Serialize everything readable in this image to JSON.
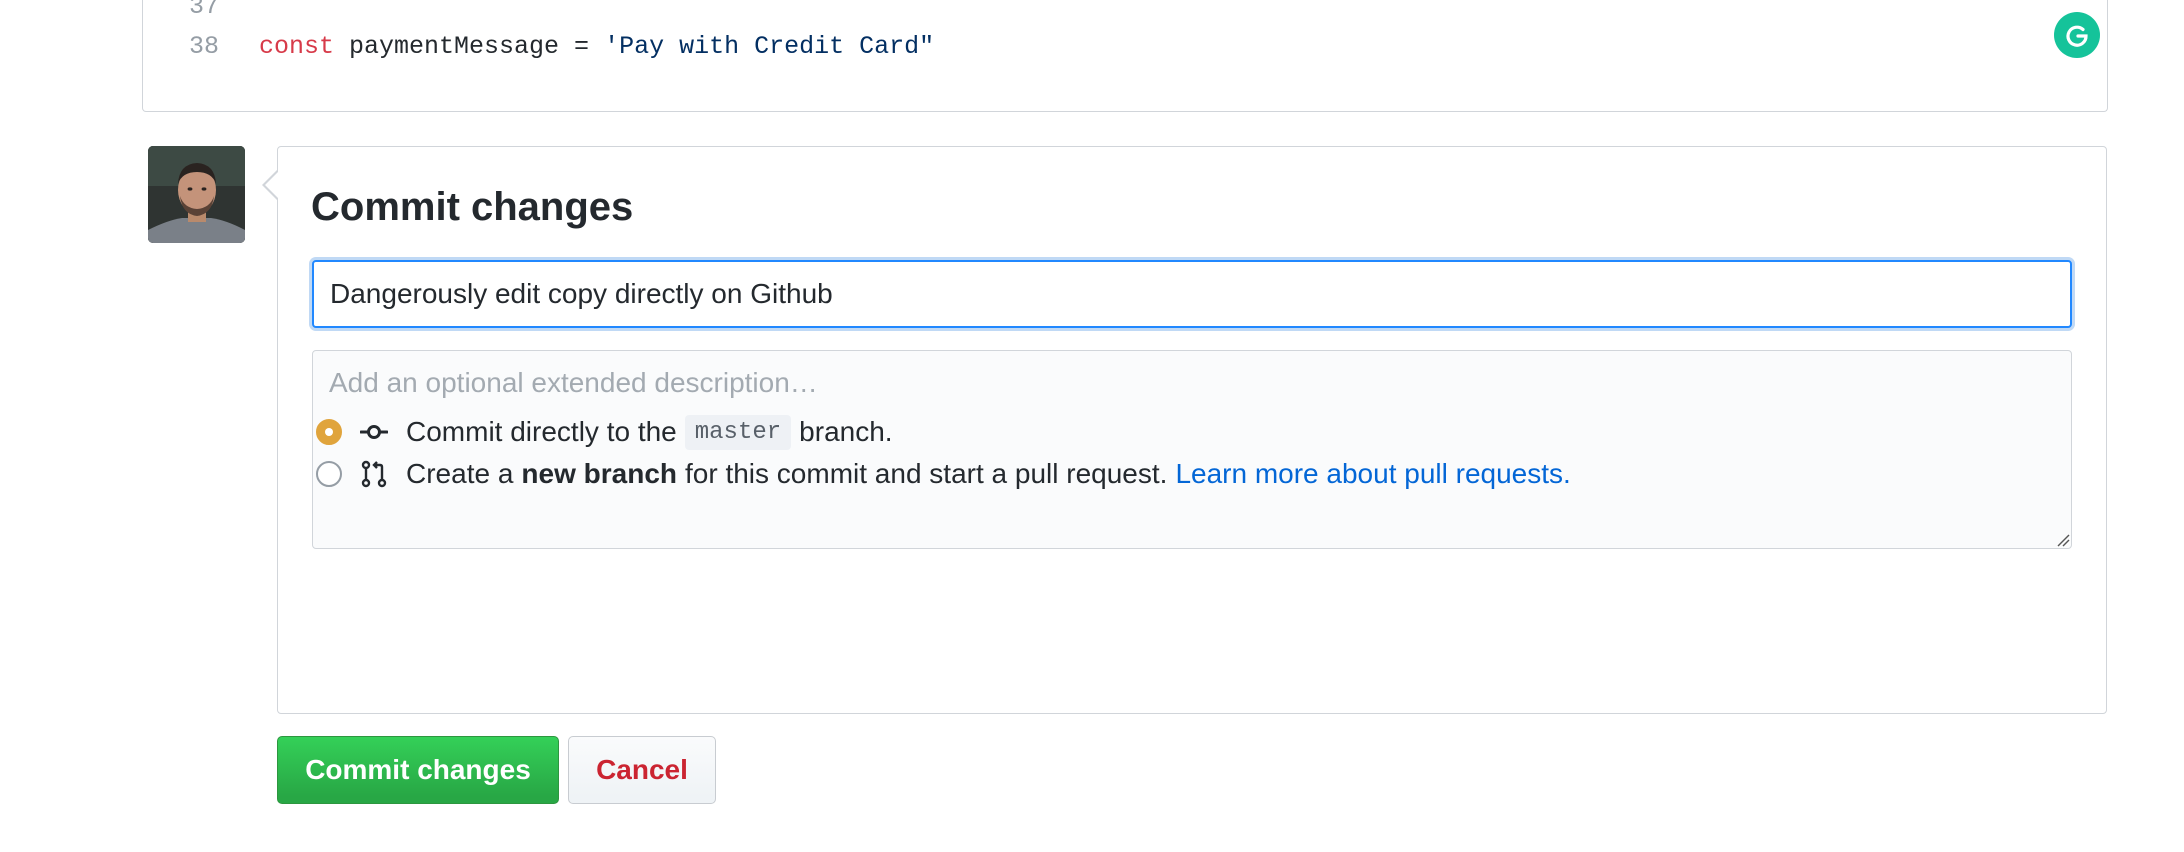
{
  "editor": {
    "lines": [
      {
        "number": "37",
        "keyword": "",
        "code": "",
        "string": ""
      },
      {
        "number": "38",
        "keyword": "const",
        "code": " paymentMessage = ",
        "string": "'Pay with Credit Card\""
      }
    ]
  },
  "avatar": {
    "alt": "user avatar"
  },
  "commit_form": {
    "title": "Commit changes",
    "summary_value": "Dangerously edit copy directly on Github",
    "description_placeholder": "Add an optional extended description…",
    "options": {
      "direct": {
        "prefix": "Commit directly to the",
        "branch": "master",
        "suffix": "branch.",
        "checked": true,
        "icon": "git-commit-icon"
      },
      "new_branch": {
        "prefix": "Create a",
        "bold": "new branch",
        "suffix": "for this commit and start a pull request.",
        "link": "Learn more about pull requests.",
        "checked": false,
        "icon": "git-pull-request-icon"
      }
    }
  },
  "buttons": {
    "commit_label": "Commit changes",
    "cancel_label": "Cancel"
  },
  "colors": {
    "accent_blue": "#0366d6",
    "commit_green": "#28a745",
    "cancel_red": "#cb2431",
    "radio_checked": "#e0a43c"
  }
}
